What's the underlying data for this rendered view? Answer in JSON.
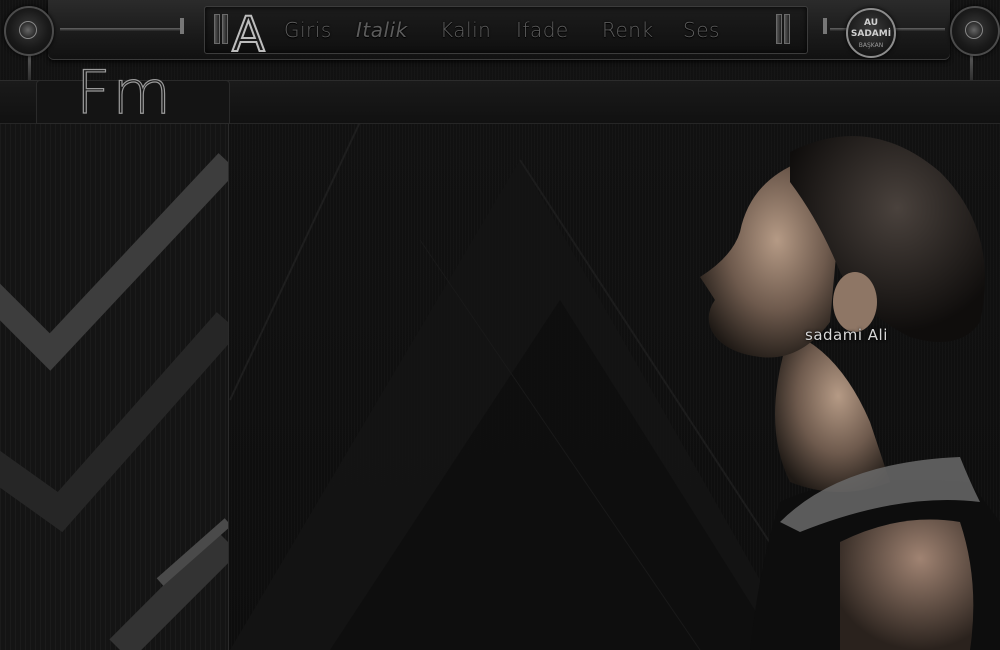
{
  "toolbar": {
    "logo_letter": "A",
    "menu": [
      {
        "label": "Giris"
      },
      {
        "label": "Italik"
      },
      {
        "label": "Kalin"
      },
      {
        "label": "Ifade"
      },
      {
        "label": "Renk"
      },
      {
        "label": "Ses"
      }
    ],
    "badge": {
      "line1": "AU",
      "line2": "SADAMİ",
      "line3": "BAŞKAN"
    }
  },
  "panel": {
    "title": "Fm"
  },
  "content": {
    "watermark": "sadami Ali"
  },
  "colors": {
    "background": "#0c0c0c",
    "menu_text": "#5c5c5c",
    "panel_border": "#3c3c3c"
  }
}
